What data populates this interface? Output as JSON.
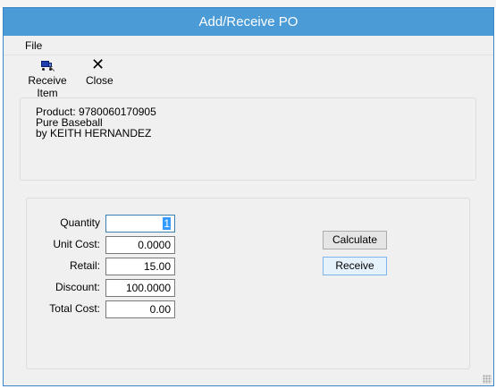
{
  "window": {
    "title": "Add/Receive PO"
  },
  "menu": {
    "file_label": "File"
  },
  "toolbar": {
    "receive_item_label": "Receive Item",
    "close_label": "Close"
  },
  "product": {
    "line1": "Product: 9780060170905",
    "line2": "Pure Baseball",
    "line3": "by KEITH HERNANDEZ"
  },
  "form": {
    "quantity": {
      "label": "Quantity",
      "value": "1"
    },
    "unit_cost": {
      "label": "Unit Cost:",
      "value": "0.0000"
    },
    "retail": {
      "label": "Retail:",
      "value": "15.00"
    },
    "discount": {
      "label": "Discount:",
      "value": "100.0000"
    },
    "total_cost": {
      "label": "Total Cost:",
      "value": "0.00"
    }
  },
  "buttons": {
    "calculate_label": "Calculate",
    "receive_label": "Receive"
  },
  "colors": {
    "title_bar": "#4a9bd6",
    "title_text": "#ffffff",
    "window_bg": "#f0f0f0",
    "selection": "#3399ff"
  }
}
